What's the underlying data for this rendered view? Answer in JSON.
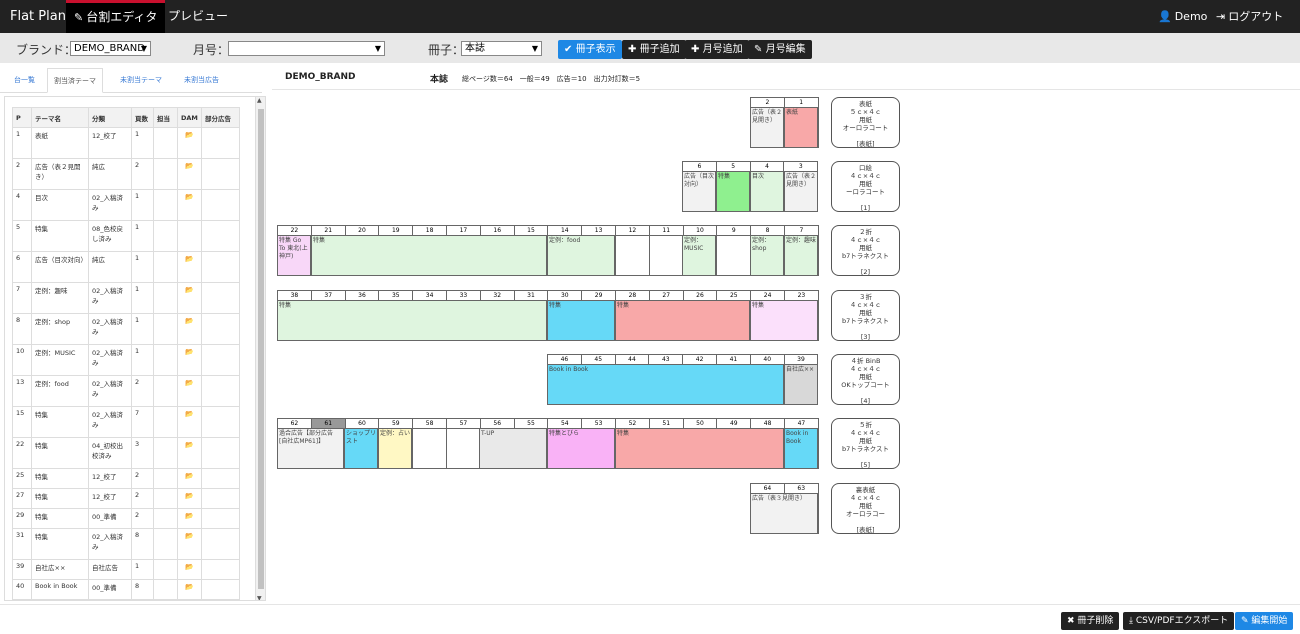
{
  "nav": {
    "brand": "Flat Plan",
    "tab_editor": "台割エディタ",
    "tab_preview": "プレビュー",
    "user": "Demo",
    "logout": "ログアウト"
  },
  "toolbar": {
    "brand_label": "ブランド：",
    "brand_value": "DEMO_BRAND",
    "month_label": "月号：",
    "month_value": "",
    "book_label": "冊子：",
    "book_value": "本誌",
    "btn_show": "冊子表示",
    "btn_add_book": "冊子追加",
    "btn_add_month": "月号追加",
    "btn_edit_month": "月号編集"
  },
  "subtabs": [
    "台一覧",
    "割当済テーマ",
    "未割当テーマ",
    "未割当広告"
  ],
  "table": {
    "headers": [
      "P",
      "テーマ名",
      "分類",
      "頁数",
      "担当",
      "DAM",
      "部分広告"
    ],
    "rows": [
      [
        "1",
        "表紙",
        "12_校了",
        "1",
        "",
        "folder",
        ""
      ],
      [
        "2",
        "広告（表２見開き）",
        "純広",
        "2",
        "",
        "folder",
        ""
      ],
      [
        "4",
        "目次",
        "02_入稿済み",
        "1",
        "",
        "folder",
        ""
      ],
      [
        "5",
        "特集",
        "08_色校戻し済み",
        "1",
        "",
        "",
        ""
      ],
      [
        "6",
        "広告（目次対向）",
        "純広",
        "1",
        "",
        "folder",
        ""
      ],
      [
        "7",
        "定例：趣味",
        "02_入稿済み",
        "1",
        "",
        "folder",
        ""
      ],
      [
        "8",
        "定例：shop",
        "02_入稿済み",
        "1",
        "",
        "folder",
        ""
      ],
      [
        "10",
        "定例：MUSIC",
        "02_入稿済み",
        "1",
        "",
        "folder",
        ""
      ],
      [
        "13",
        "定例：food",
        "02_入稿済み",
        "2",
        "",
        "folder",
        ""
      ],
      [
        "15",
        "特集",
        "02_入稿済み",
        "7",
        "",
        "folder",
        ""
      ],
      [
        "22",
        "特集",
        "04_初校出校済み",
        "3",
        "",
        "folder",
        ""
      ],
      [
        "25",
        "特集",
        "12_校了",
        "2",
        "",
        "folder",
        ""
      ],
      [
        "27",
        "特集",
        "12_校了",
        "2",
        "",
        "folder",
        ""
      ],
      [
        "29",
        "特集",
        "00_準備",
        "2",
        "",
        "folder",
        ""
      ],
      [
        "31",
        "特集",
        "02_入稿済み",
        "8",
        "",
        "folder",
        ""
      ],
      [
        "39",
        "自社広××",
        "自社広告",
        "1",
        "",
        "folder",
        ""
      ],
      [
        "40",
        "Book in Book",
        "00_準備",
        "8",
        "",
        "folder",
        ""
      ]
    ]
  },
  "book_header": {
    "brand": "DEMO_BRAND",
    "book": "本誌",
    "stats": "総ページ数＝64　一般＝49　広告＝10　出力対訂数＝5"
  },
  "pages": {
    "r1": [
      "2",
      "1"
    ],
    "r2": [
      "6",
      "5",
      "4",
      "3"
    ],
    "r3": [
      "22",
      "21",
      "20",
      "19",
      "18",
      "17",
      "16",
      "15",
      "14",
      "13",
      "12",
      "11",
      "10",
      "9",
      "8",
      "7"
    ],
    "r4": [
      "38",
      "37",
      "36",
      "35",
      "34",
      "33",
      "32",
      "31",
      "30",
      "29",
      "28",
      "27",
      "26",
      "25",
      "24",
      "23"
    ],
    "r5": [
      "46",
      "45",
      "44",
      "43",
      "42",
      "41",
      "40",
      "39"
    ],
    "r6": [
      "62",
      "61",
      "60",
      "59",
      "58",
      "57",
      "56",
      "55",
      "54",
      "53",
      "52",
      "51",
      "50",
      "49",
      "48",
      "47"
    ],
    "r7": [
      "64",
      "63"
    ]
  },
  "contents": {
    "r1_ad": "広告（表２見開き）",
    "r1_cover": "表紙",
    "r2_ad": "広告（目次対向）",
    "r2_special": "特集",
    "r2_toc": "目次",
    "r2_ad2": "広告（表２見開き）",
    "r3_special1": "特集 Go To 東北(上神戸)",
    "r3_special2": "特集",
    "r3_food": "定例：food",
    "r3_music": "定例：MUSIC",
    "r3_shop": "定例：shop",
    "r3_hobby": "定例：趣味",
    "r4_special": "特集",
    "r4_s2": "特集",
    "r4_s3": "特集",
    "r5_bib": "Book in Book",
    "r5_self": "自社広××",
    "r6_combo": "過合広告【部分広告 [自社広MP61]】",
    "r6_shop": "ショップリスト",
    "r6_fortune": "定例：占い",
    "r6_tup": "T-UP",
    "r6_tobira": "特集とびら",
    "r6_special": "特集",
    "r6_bib": "Book in Book",
    "r7_ad": "広告（表３見開き）"
  },
  "info_boxes": [
    [
      "表紙",
      "５ｃ×４ｃ",
      "用紙",
      "オーロラコート",
      "",
      "[表紙]"
    ],
    [
      "口絵",
      "４ｃ×４ｃ",
      "用紙",
      "ーロラコート",
      "",
      "[1]"
    ],
    [
      "２折",
      "４ｃ×４ｃ",
      "用紙",
      "b7トラネクスト",
      "",
      "[2]"
    ],
    [
      "３折",
      "４ｃ×４ｃ",
      "用紙",
      "b7トラネクスト",
      "",
      "[3]"
    ],
    [
      "４折 BinB",
      "４ｃ×４ｃ",
      "用紙",
      "OKトップコート",
      "",
      "[4]"
    ],
    [
      "５折",
      "４ｃ×４ｃ",
      "用紙",
      "b7トラネクスト",
      "",
      "[5]"
    ],
    [
      "裏表紙",
      "４ｃ×４ｃ",
      "用紙",
      "オーロラコー",
      "",
      "[表紙]"
    ]
  ],
  "bottom": {
    "delete": "冊子削除",
    "export": "CSV/PDFエクスポート",
    "start_edit": "編集開始"
  },
  "colors": {
    "navbar": "#222222",
    "accent_blue": "#1e88e5",
    "active_tab_border": "#c8102e"
  }
}
